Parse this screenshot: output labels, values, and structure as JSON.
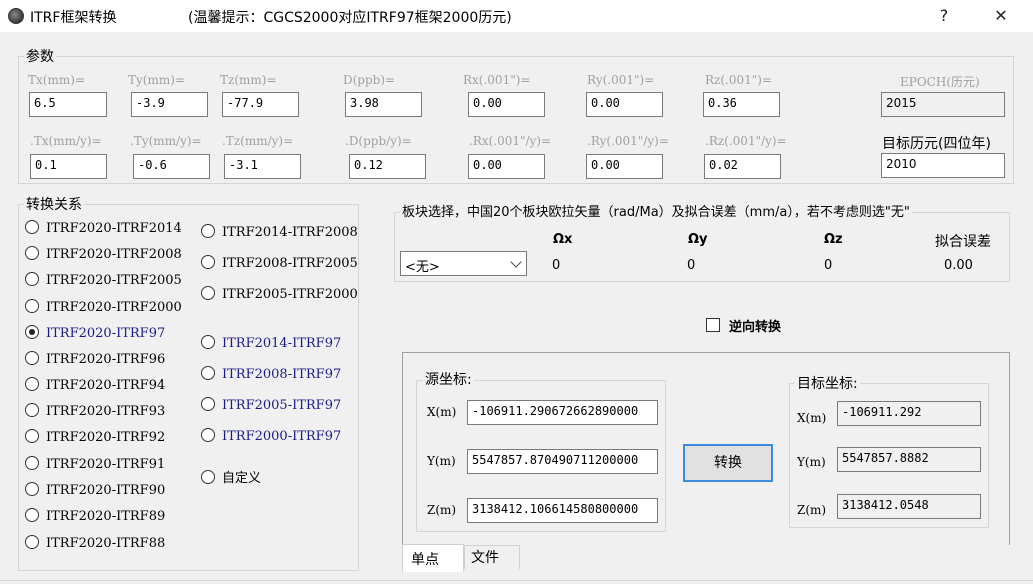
{
  "window": {
    "title": "ITRF框架转换",
    "hint": "(温馨提示：CGCS2000对应ITRF97框架2000历元)",
    "help_label": "?",
    "close_label": "✕"
  },
  "params": {
    "group_label": "参数",
    "row1": [
      {
        "label": "Tx(mm)=",
        "value": "6.5"
      },
      {
        "label": "Ty(mm)=",
        "value": "-3.9"
      },
      {
        "label": "Tz(mm)=",
        "value": "-77.9"
      },
      {
        "label": "D(ppb)=",
        "value": "3.98"
      },
      {
        "label": "Rx(.001\")=",
        "value": "0.00"
      },
      {
        "label": "Ry(.001\")=",
        "value": "0.00"
      },
      {
        "label": "Rz(.001\")=",
        "value": "0.36"
      }
    ],
    "row2": [
      {
        "label": ".Tx(mm/y)=",
        "value": "0.1"
      },
      {
        "label": ".Ty(mm/y)=",
        "value": "-0.6"
      },
      {
        "label": ".Tz(mm/y)=",
        "value": "-3.1"
      },
      {
        "label": ".D(ppb/y)=",
        "value": "0.12"
      },
      {
        "label": ".Rx(.001\"/y)=",
        "value": "0.00"
      },
      {
        "label": ".Ry(.001\"/y)=",
        "value": "0.00"
      },
      {
        "label": ".Rz(.001\"/y)=",
        "value": "0.02"
      }
    ],
    "epoch_label": "EPOCH(历元)",
    "epoch_value": "2015",
    "target_epoch_label": "目标历元(四位年)",
    "target_epoch_value": "2010"
  },
  "transform": {
    "group_label": "转换关系",
    "left": [
      {
        "label": "ITRF2020-ITRF2014",
        "checked": false,
        "blue": false
      },
      {
        "label": "ITRF2020-ITRF2008",
        "checked": false,
        "blue": false
      },
      {
        "label": "ITRF2020-ITRF2005",
        "checked": false,
        "blue": false
      },
      {
        "label": "ITRF2020-ITRF2000",
        "checked": false,
        "blue": false
      },
      {
        "label": "ITRF2020-ITRF97",
        "checked": true,
        "blue": true
      },
      {
        "label": "ITRF2020-ITRF96",
        "checked": false,
        "blue": false
      },
      {
        "label": "ITRF2020-ITRF94",
        "checked": false,
        "blue": false
      },
      {
        "label": "ITRF2020-ITRF93",
        "checked": false,
        "blue": false
      },
      {
        "label": "ITRF2020-ITRF92",
        "checked": false,
        "blue": false
      },
      {
        "label": "ITRF2020-ITRF91",
        "checked": false,
        "blue": false
      },
      {
        "label": "ITRF2020-ITRF90",
        "checked": false,
        "blue": false
      },
      {
        "label": "ITRF2020-ITRF89",
        "checked": false,
        "blue": false
      },
      {
        "label": "ITRF2020-ITRF88",
        "checked": false,
        "blue": false
      }
    ],
    "right": [
      {
        "label": "ITRF2014-ITRF2008",
        "checked": false,
        "blue": false
      },
      {
        "label": "ITRF2008-ITRF2005",
        "checked": false,
        "blue": false
      },
      {
        "label": "ITRF2005-ITRF2000",
        "checked": false,
        "blue": false
      },
      {
        "label": "ITRF2014-ITRF97",
        "checked": false,
        "blue": true
      },
      {
        "label": "ITRF2008-ITRF97",
        "checked": false,
        "blue": true
      },
      {
        "label": "ITRF2005-ITRF97",
        "checked": false,
        "blue": true
      },
      {
        "label": "ITRF2000-ITRF97",
        "checked": false,
        "blue": true
      },
      {
        "label": "自定义",
        "checked": false,
        "blue": false
      }
    ]
  },
  "plate": {
    "group_label": "板块选择，中国20个板块欧拉矢量（rad/Ma）及拟合误差（mm/a），若不考虑则选\"无\"",
    "select_value": "<无>",
    "headers": {
      "ox": "Ωx",
      "oy": "Ωy",
      "oz": "Ωz",
      "err": "拟合误差"
    },
    "values": {
      "ox": "0",
      "oy": "0",
      "oz": "0",
      "err": "0.00"
    }
  },
  "reverse_label": "逆向转换",
  "source": {
    "group_label": "源坐标:",
    "x_label": "X(m)",
    "x_value": "-106911.290672662890000",
    "y_label": "Y(m)",
    "y_value": "5547857.870490711200000",
    "z_label": "Z(m)",
    "z_value": "3138412.106614580800000"
  },
  "convert_label": "转换",
  "target": {
    "group_label": "目标坐标:",
    "x_label": "X(m)",
    "x_value": "-106911.292",
    "y_label": "Y(m)",
    "y_value": "5547857.8882",
    "z_label": "Z(m)",
    "z_value": "3138412.0548"
  },
  "tabs": [
    "单点",
    "文件"
  ]
}
